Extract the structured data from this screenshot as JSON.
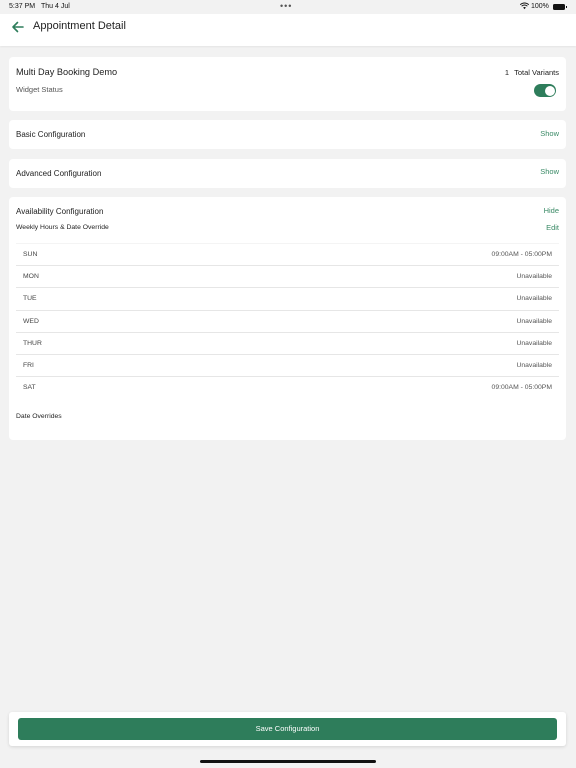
{
  "status_bar": {
    "time": "5:37 PM",
    "date": "Thu 4 Jul",
    "battery_pct": "100%",
    "dots": "•••"
  },
  "header": {
    "title": "Appointment Detail"
  },
  "booking": {
    "name": "Multi Day Booking Demo",
    "variant_count": "1",
    "variant_label": "Total Variants",
    "widget_status_label": "Widget Status",
    "widget_status_on": true
  },
  "basic_config": {
    "title": "Basic Configuration",
    "action": "Show"
  },
  "advanced_config": {
    "title": "Advanced Configuration",
    "action": "Show"
  },
  "availability": {
    "title": "Availability Configuration",
    "action": "Hide",
    "subtitle": "Weekly Hours & Date Override",
    "edit_label": "Edit",
    "schedule": [
      {
        "day": "SUN",
        "hours": "09:00AM - 05:00PM"
      },
      {
        "day": "MON",
        "hours": "Unavailable"
      },
      {
        "day": "TUE",
        "hours": "Unavailable"
      },
      {
        "day": "WED",
        "hours": "Unavailable"
      },
      {
        "day": "THUR",
        "hours": "Unavailable"
      },
      {
        "day": "FRI",
        "hours": "Unavailable"
      },
      {
        "day": "SAT",
        "hours": "09:00AM - 05:00PM"
      }
    ],
    "date_overrides_label": "Date Overrides"
  },
  "footer": {
    "save_label": "Save Configuration"
  },
  "colors": {
    "accent": "#2e7d5b",
    "link": "#3a8a66",
    "background": "#f2f2f2"
  },
  "icons": {
    "back": "arrow-left-icon",
    "wifi": "wifi-icon",
    "battery": "battery-icon"
  }
}
